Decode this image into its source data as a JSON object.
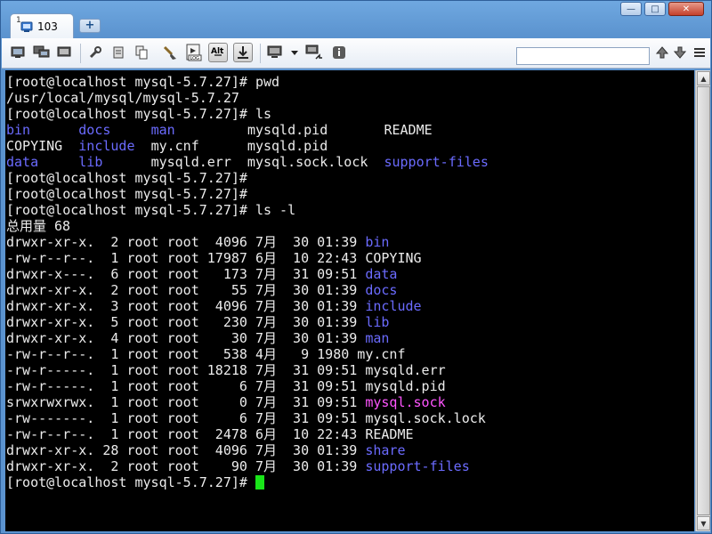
{
  "window": {
    "tab_number": "1",
    "tab_title": "103",
    "new_tab_label": "+",
    "min_label": "—",
    "max_label": "□",
    "close_label": "✕"
  },
  "toolbar": {
    "icons": [
      "new-session-icon",
      "duplicate-icon",
      "sessions-icon",
      "tools-icon",
      "copy-icon",
      "brush-icon",
      "log-icon",
      "alt-key-icon",
      "download-icon",
      "monitor-icon",
      "transfer-icon",
      "info-icon",
      "search-up-icon",
      "search-down-icon",
      "menu-icon"
    ],
    "log_label": "LOG",
    "alt_label": "Alt",
    "search_value": ""
  },
  "terminal": {
    "lines": [
      [
        {
          "t": "[root@localhost mysql-5.7.27]# pwd",
          "c": "white"
        }
      ],
      [
        {
          "t": "/usr/local/mysql/mysql-5.7.27",
          "c": "white"
        }
      ],
      [
        {
          "t": "[root@localhost mysql-5.7.27]# ls",
          "c": "white"
        }
      ],
      [
        {
          "t": "bin      ",
          "c": "blue"
        },
        {
          "t": "docs     ",
          "c": "blue"
        },
        {
          "t": "man         ",
          "c": "blue"
        },
        {
          "t": "mysqld.pid       README",
          "c": "white"
        }
      ],
      [
        {
          "t": "COPYING  ",
          "c": "white"
        },
        {
          "t": "include  ",
          "c": "blue"
        },
        {
          "t": "my.cnf      mysqld.pid ",
          "c": "white"
        }
      ],
      [
        {
          "t": "data     ",
          "c": "blue"
        },
        {
          "t": "lib      ",
          "c": "blue"
        },
        {
          "t": "mysqld.err  mysql.sock.lock  ",
          "c": "white"
        },
        {
          "t": "support-files",
          "c": "blue"
        }
      ],
      [
        {
          "t": "[root@localhost mysql-5.7.27]#",
          "c": "white"
        }
      ],
      [
        {
          "t": "[root@localhost mysql-5.7.27]#",
          "c": "white"
        }
      ],
      [
        {
          "t": "[root@localhost mysql-5.7.27]# ls -l",
          "c": "white"
        }
      ],
      [
        {
          "t": "总用量 68",
          "c": "white"
        }
      ],
      [
        {
          "t": "drwxr-xr-x.  2 root root  4096 7月  30 01:39 ",
          "c": "white"
        },
        {
          "t": "bin",
          "c": "blue"
        }
      ],
      [
        {
          "t": "-rw-r--r--.  1 root root 17987 6月  10 22:43 COPYING",
          "c": "white"
        }
      ],
      [
        {
          "t": "drwxr-x---.  6 root root   173 7月  31 09:51 ",
          "c": "white"
        },
        {
          "t": "data",
          "c": "blue"
        }
      ],
      [
        {
          "t": "drwxr-xr-x.  2 root root    55 7月  30 01:39 ",
          "c": "white"
        },
        {
          "t": "docs",
          "c": "blue"
        }
      ],
      [
        {
          "t": "drwxr-xr-x.  3 root root  4096 7月  30 01:39 ",
          "c": "white"
        },
        {
          "t": "include",
          "c": "blue"
        }
      ],
      [
        {
          "t": "drwxr-xr-x.  5 root root   230 7月  30 01:39 ",
          "c": "white"
        },
        {
          "t": "lib",
          "c": "blue"
        }
      ],
      [
        {
          "t": "drwxr-xr-x.  4 root root    30 7月  30 01:39 ",
          "c": "white"
        },
        {
          "t": "man",
          "c": "blue"
        }
      ],
      [
        {
          "t": "-rw-r--r--.  1 root root   538 4月   9 1980 my.cnf",
          "c": "white"
        }
      ],
      [
        {
          "t": "-rw-r-----.  1 root root 18218 7月  31 09:51 mysqld.err",
          "c": "white"
        }
      ],
      [
        {
          "t": "-rw-r-----.  1 root root     6 7月  31 09:51 mysqld.pid",
          "c": "white"
        }
      ],
      [
        {
          "t": "srwxrwxrwx.  1 root root     0 7月  31 09:51 ",
          "c": "white"
        },
        {
          "t": "mysql.sock",
          "c": "mag"
        }
      ],
      [
        {
          "t": "-rw-------.  1 root root     6 7月  31 09:51 mysql.sock.lock",
          "c": "white"
        }
      ],
      [
        {
          "t": "-rw-r--r--.  1 root root  2478 6月  10 22:43 README",
          "c": "white"
        }
      ],
      [
        {
          "t": "drwxr-xr-x. 28 root root  4096 7月  30 01:39 ",
          "c": "white"
        },
        {
          "t": "share",
          "c": "blue"
        }
      ],
      [
        {
          "t": "drwxr-xr-x.  2 root root    90 7月  30 01:39 ",
          "c": "white"
        },
        {
          "t": "support-files",
          "c": "blue"
        }
      ],
      [
        {
          "t": "[root@localhost mysql-5.7.27]# ",
          "c": "white"
        }
      ]
    ],
    "colors": {
      "white": "#ececec",
      "blue": "#6b6bff",
      "mag": "#ff55ff",
      "cursor": "#19e519",
      "background": "#000000"
    }
  },
  "scrollbar": {
    "up_label": "▲",
    "down_label": "▼"
  }
}
